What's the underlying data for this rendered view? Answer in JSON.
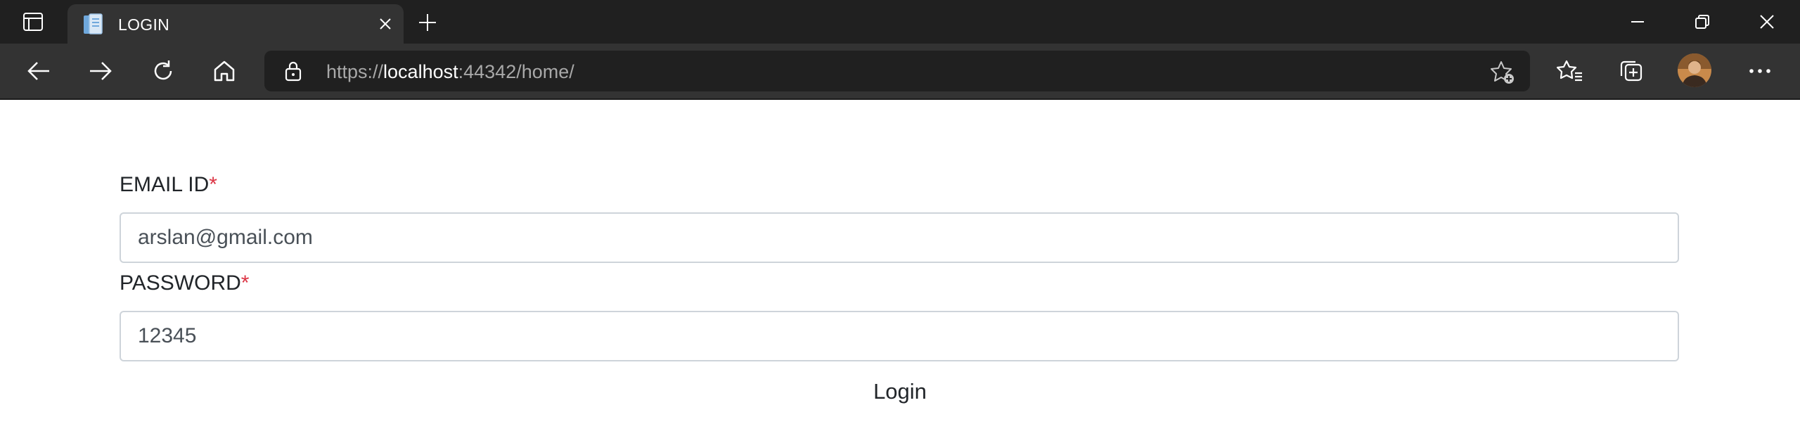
{
  "browser": {
    "tab": {
      "title": "LOGIN"
    },
    "address": {
      "scheme": "https://",
      "host": "localhost",
      "rest": ":44342/home/"
    }
  },
  "form": {
    "email": {
      "label": "EMAIL ID",
      "required_mark": "*",
      "value": "arslan@gmail.com"
    },
    "password": {
      "label": "PASSWORD",
      "required_mark": "*",
      "value": "12345"
    },
    "submit_label": "Login"
  },
  "icons": {
    "tab_actions": "tab-actions-icon",
    "favicon": "page-favicon-icon",
    "close": "close-icon",
    "new_tab": "plus-icon",
    "back": "back-arrow-icon",
    "forward": "forward-arrow-icon",
    "refresh": "refresh-icon",
    "home": "home-icon",
    "lock": "lock-icon",
    "add_favorite": "star-add-icon",
    "favorites": "favorites-icon",
    "collections": "collections-icon",
    "more": "more-icon"
  },
  "colors": {
    "titlebar": "#202020",
    "toolbar": "#333333",
    "required": "#dc3545",
    "input_border": "#ced4da"
  }
}
